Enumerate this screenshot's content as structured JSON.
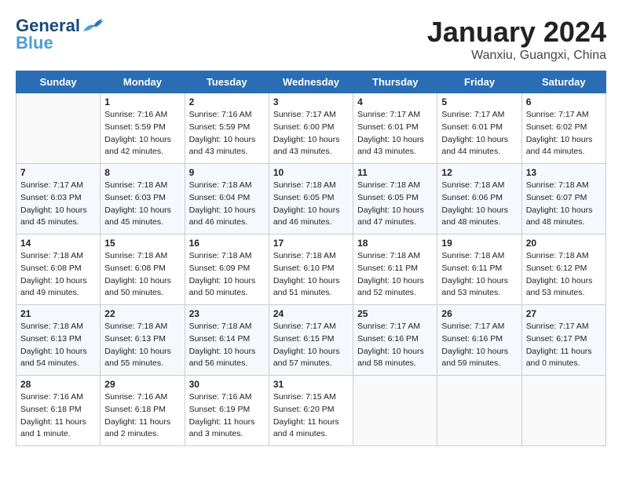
{
  "header": {
    "logo_general": "General",
    "logo_blue": "Blue",
    "month": "January 2024",
    "location": "Wanxiu, Guangxi, China"
  },
  "days_of_week": [
    "Sunday",
    "Monday",
    "Tuesday",
    "Wednesday",
    "Thursday",
    "Friday",
    "Saturday"
  ],
  "weeks": [
    [
      {
        "day": "",
        "info": ""
      },
      {
        "day": "1",
        "info": "Sunrise: 7:16 AM\nSunset: 5:59 PM\nDaylight: 10 hours\nand 42 minutes."
      },
      {
        "day": "2",
        "info": "Sunrise: 7:16 AM\nSunset: 5:59 PM\nDaylight: 10 hours\nand 43 minutes."
      },
      {
        "day": "3",
        "info": "Sunrise: 7:17 AM\nSunset: 6:00 PM\nDaylight: 10 hours\nand 43 minutes."
      },
      {
        "day": "4",
        "info": "Sunrise: 7:17 AM\nSunset: 6:01 PM\nDaylight: 10 hours\nand 43 minutes."
      },
      {
        "day": "5",
        "info": "Sunrise: 7:17 AM\nSunset: 6:01 PM\nDaylight: 10 hours\nand 44 minutes."
      },
      {
        "day": "6",
        "info": "Sunrise: 7:17 AM\nSunset: 6:02 PM\nDaylight: 10 hours\nand 44 minutes."
      }
    ],
    [
      {
        "day": "7",
        "info": "Sunrise: 7:17 AM\nSunset: 6:03 PM\nDaylight: 10 hours\nand 45 minutes."
      },
      {
        "day": "8",
        "info": "Sunrise: 7:18 AM\nSunset: 6:03 PM\nDaylight: 10 hours\nand 45 minutes."
      },
      {
        "day": "9",
        "info": "Sunrise: 7:18 AM\nSunset: 6:04 PM\nDaylight: 10 hours\nand 46 minutes."
      },
      {
        "day": "10",
        "info": "Sunrise: 7:18 AM\nSunset: 6:05 PM\nDaylight: 10 hours\nand 46 minutes."
      },
      {
        "day": "11",
        "info": "Sunrise: 7:18 AM\nSunset: 6:05 PM\nDaylight: 10 hours\nand 47 minutes."
      },
      {
        "day": "12",
        "info": "Sunrise: 7:18 AM\nSunset: 6:06 PM\nDaylight: 10 hours\nand 48 minutes."
      },
      {
        "day": "13",
        "info": "Sunrise: 7:18 AM\nSunset: 6:07 PM\nDaylight: 10 hours\nand 48 minutes."
      }
    ],
    [
      {
        "day": "14",
        "info": "Sunrise: 7:18 AM\nSunset: 6:08 PM\nDaylight: 10 hours\nand 49 minutes."
      },
      {
        "day": "15",
        "info": "Sunrise: 7:18 AM\nSunset: 6:08 PM\nDaylight: 10 hours\nand 50 minutes."
      },
      {
        "day": "16",
        "info": "Sunrise: 7:18 AM\nSunset: 6:09 PM\nDaylight: 10 hours\nand 50 minutes."
      },
      {
        "day": "17",
        "info": "Sunrise: 7:18 AM\nSunset: 6:10 PM\nDaylight: 10 hours\nand 51 minutes."
      },
      {
        "day": "18",
        "info": "Sunrise: 7:18 AM\nSunset: 6:11 PM\nDaylight: 10 hours\nand 52 minutes."
      },
      {
        "day": "19",
        "info": "Sunrise: 7:18 AM\nSunset: 6:11 PM\nDaylight: 10 hours\nand 53 minutes."
      },
      {
        "day": "20",
        "info": "Sunrise: 7:18 AM\nSunset: 6:12 PM\nDaylight: 10 hours\nand 53 minutes."
      }
    ],
    [
      {
        "day": "21",
        "info": "Sunrise: 7:18 AM\nSunset: 6:13 PM\nDaylight: 10 hours\nand 54 minutes."
      },
      {
        "day": "22",
        "info": "Sunrise: 7:18 AM\nSunset: 6:13 PM\nDaylight: 10 hours\nand 55 minutes."
      },
      {
        "day": "23",
        "info": "Sunrise: 7:18 AM\nSunset: 6:14 PM\nDaylight: 10 hours\nand 56 minutes."
      },
      {
        "day": "24",
        "info": "Sunrise: 7:17 AM\nSunset: 6:15 PM\nDaylight: 10 hours\nand 57 minutes."
      },
      {
        "day": "25",
        "info": "Sunrise: 7:17 AM\nSunset: 6:16 PM\nDaylight: 10 hours\nand 58 minutes."
      },
      {
        "day": "26",
        "info": "Sunrise: 7:17 AM\nSunset: 6:16 PM\nDaylight: 10 hours\nand 59 minutes."
      },
      {
        "day": "27",
        "info": "Sunrise: 7:17 AM\nSunset: 6:17 PM\nDaylight: 11 hours\nand 0 minutes."
      }
    ],
    [
      {
        "day": "28",
        "info": "Sunrise: 7:16 AM\nSunset: 6:18 PM\nDaylight: 11 hours\nand 1 minute."
      },
      {
        "day": "29",
        "info": "Sunrise: 7:16 AM\nSunset: 6:18 PM\nDaylight: 11 hours\nand 2 minutes."
      },
      {
        "day": "30",
        "info": "Sunrise: 7:16 AM\nSunset: 6:19 PM\nDaylight: 11 hours\nand 3 minutes."
      },
      {
        "day": "31",
        "info": "Sunrise: 7:15 AM\nSunset: 6:20 PM\nDaylight: 11 hours\nand 4 minutes."
      },
      {
        "day": "",
        "info": ""
      },
      {
        "day": "",
        "info": ""
      },
      {
        "day": "",
        "info": ""
      }
    ]
  ]
}
